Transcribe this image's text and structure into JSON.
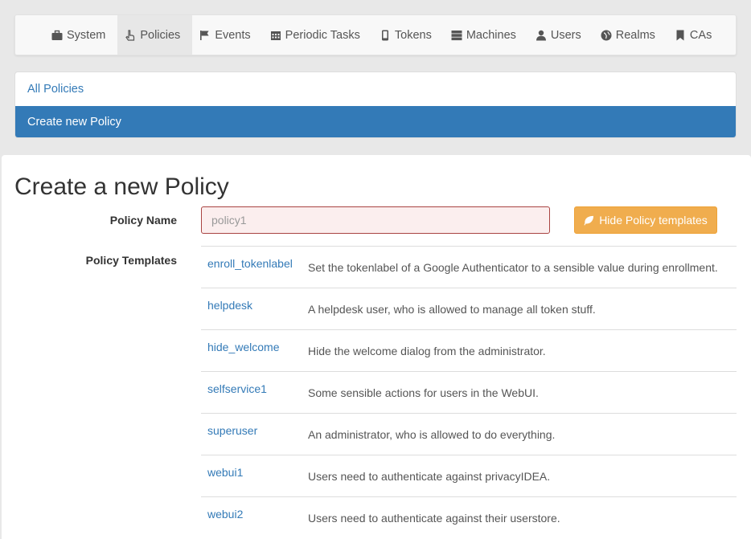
{
  "nav": {
    "items": [
      {
        "label": "System",
        "icon": "briefcase-icon",
        "active": false
      },
      {
        "label": "Policies",
        "icon": "hand-pointer-icon",
        "active": true
      },
      {
        "label": "Events",
        "icon": "flag-icon",
        "active": false
      },
      {
        "label": "Periodic Tasks",
        "icon": "calendar-icon",
        "active": false
      },
      {
        "label": "Tokens",
        "icon": "phone-icon",
        "active": false
      },
      {
        "label": "Machines",
        "icon": "server-icon",
        "active": false
      },
      {
        "label": "Users",
        "icon": "user-icon",
        "active": false
      },
      {
        "label": "Realms",
        "icon": "globe-icon",
        "active": false
      },
      {
        "label": "CAs",
        "icon": "bookmark-icon",
        "active": false
      }
    ]
  },
  "submenu": {
    "all_policies": "All Policies",
    "create_new": "Create new Policy"
  },
  "main": {
    "title": "Create a new Policy",
    "policy_name_label": "Policy Name",
    "policy_name_placeholder": "policy1",
    "policy_name_value": "",
    "hide_templates_button": "Hide Policy templates",
    "templates_label": "Policy Templates",
    "templates": [
      {
        "name": "enroll_tokenlabel",
        "description": "Set the tokenlabel of a Google Authenticator to a sensible value during enrollment."
      },
      {
        "name": "helpdesk",
        "description": "A helpdesk user, who is allowed to manage all token stuff."
      },
      {
        "name": "hide_welcome",
        "description": "Hide the welcome dialog from the administrator."
      },
      {
        "name": "selfservice1",
        "description": "Some sensible actions for users in the WebUI."
      },
      {
        "name": "superuser",
        "description": "An administrator, who is allowed to do everything."
      },
      {
        "name": "webui1",
        "description": "Users need to authenticate against privacyIDEA."
      },
      {
        "name": "webui2",
        "description": "Users need to authenticate against their userstore."
      }
    ]
  },
  "colors": {
    "link": "#337ab7",
    "active_submenu_bg": "#337ab7",
    "warning_button": "#f0ad4e",
    "error_border": "#a94442"
  }
}
